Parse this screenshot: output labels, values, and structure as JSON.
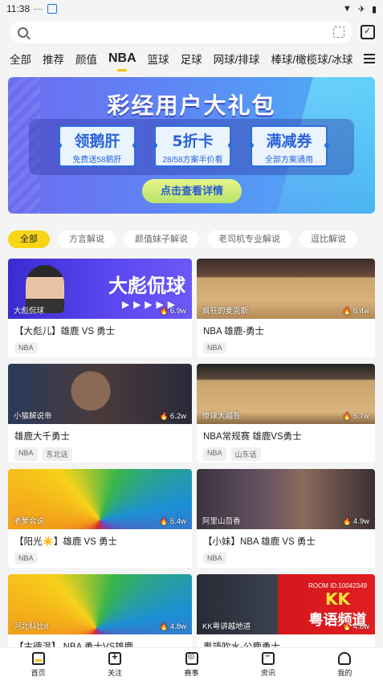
{
  "status": {
    "time": "11:38",
    "dots": "·····"
  },
  "search": {
    "placeholder": ""
  },
  "tabs": [
    "全部",
    "推荐",
    "颜值",
    "NBA",
    "篮球",
    "足球",
    "网球/排球",
    "棒球/橄榄球/冰球"
  ],
  "active_tab": "NBA",
  "banner": {
    "title": "彩经用户大礼包",
    "coupons": [
      {
        "big": "领鹅肝",
        "small": "免费送58鹅肝"
      },
      {
        "big": "5折卡",
        "small": "28/58方案半价看"
      },
      {
        "big": "满减券",
        "small": "全部方案通用"
      }
    ],
    "button": "点击查看详情"
  },
  "chips": [
    "全部",
    "方言解说",
    "颜值妹子解说",
    "老司机专业解说",
    "逗比解说"
  ],
  "cards": [
    {
      "author": "大彪侃球",
      "views": "6.9w",
      "title": "【大彪儿】雄鹿 VS 勇士",
      "tags": [
        "NBA"
      ],
      "promo": "大彪侃球"
    },
    {
      "author": "疯狂的麦克斯",
      "views": "6.4w",
      "title": "NBA 雄鹿-勇士",
      "tags": [
        "NBA"
      ]
    },
    {
      "author": "小猫解说帝",
      "views": "6.2w",
      "title": "雄鹿大千勇士",
      "tags": [
        "NBA",
        "东北话"
      ]
    },
    {
      "author": "惨球大越吾",
      "views": "5.7w",
      "title": "NBA常规赛 雄鹿VS勇士",
      "tags": [
        "NBA",
        "山东话"
      ]
    },
    {
      "author": "老萝会说",
      "views": "5.4w",
      "title": "【阳光☀️】雄鹿 VS 勇士",
      "tags": [
        "NBA"
      ]
    },
    {
      "author": "阿里山茴香",
      "views": "4.9w",
      "title": "【小妹】NBA 雄鹿 VS 勇士",
      "tags": [
        "NBA"
      ]
    },
    {
      "author": "河北科比8",
      "views": "4.8w",
      "title": "【古德温】 NBA  勇士VS雄鹿",
      "tags": []
    },
    {
      "author": "KK粤讲越地道",
      "views": "4.8w",
      "title": "粤語吹水-公鹿勇士",
      "tags": [],
      "kk": {
        "l1": "ROOM ID:10042349",
        "l2": "KK",
        "l3": "粤语频道"
      }
    }
  ],
  "bottom_nav": [
    "首页",
    "关注",
    "赛事",
    "资讯",
    "我的"
  ],
  "colors": {
    "accent": "#f9d518",
    "banner_start": "#6d6cf0",
    "banner_end": "#49b4f2"
  }
}
